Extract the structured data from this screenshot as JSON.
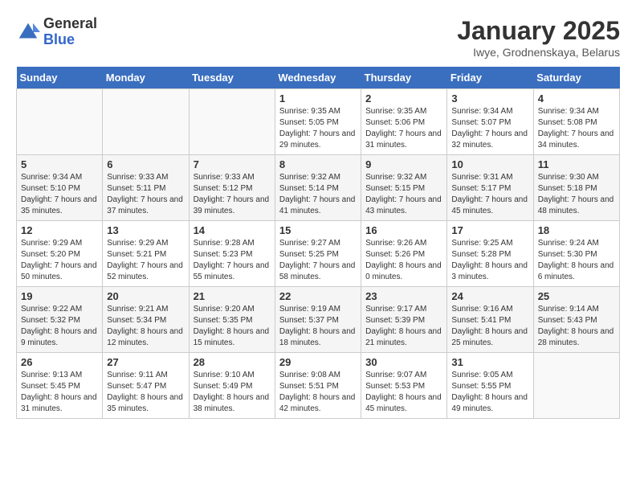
{
  "logo": {
    "general": "General",
    "blue": "Blue"
  },
  "title": "January 2025",
  "subtitle": "Iwye, Grodnenskaya, Belarus",
  "days_of_week": [
    "Sunday",
    "Monday",
    "Tuesday",
    "Wednesday",
    "Thursday",
    "Friday",
    "Saturday"
  ],
  "weeks": [
    [
      {
        "day": "",
        "info": ""
      },
      {
        "day": "",
        "info": ""
      },
      {
        "day": "",
        "info": ""
      },
      {
        "day": "1",
        "info": "Sunrise: 9:35 AM\nSunset: 5:05 PM\nDaylight: 7 hours and 29 minutes."
      },
      {
        "day": "2",
        "info": "Sunrise: 9:35 AM\nSunset: 5:06 PM\nDaylight: 7 hours and 31 minutes."
      },
      {
        "day": "3",
        "info": "Sunrise: 9:34 AM\nSunset: 5:07 PM\nDaylight: 7 hours and 32 minutes."
      },
      {
        "day": "4",
        "info": "Sunrise: 9:34 AM\nSunset: 5:08 PM\nDaylight: 7 hours and 34 minutes."
      }
    ],
    [
      {
        "day": "5",
        "info": "Sunrise: 9:34 AM\nSunset: 5:10 PM\nDaylight: 7 hours and 35 minutes."
      },
      {
        "day": "6",
        "info": "Sunrise: 9:33 AM\nSunset: 5:11 PM\nDaylight: 7 hours and 37 minutes."
      },
      {
        "day": "7",
        "info": "Sunrise: 9:33 AM\nSunset: 5:12 PM\nDaylight: 7 hours and 39 minutes."
      },
      {
        "day": "8",
        "info": "Sunrise: 9:32 AM\nSunset: 5:14 PM\nDaylight: 7 hours and 41 minutes."
      },
      {
        "day": "9",
        "info": "Sunrise: 9:32 AM\nSunset: 5:15 PM\nDaylight: 7 hours and 43 minutes."
      },
      {
        "day": "10",
        "info": "Sunrise: 9:31 AM\nSunset: 5:17 PM\nDaylight: 7 hours and 45 minutes."
      },
      {
        "day": "11",
        "info": "Sunrise: 9:30 AM\nSunset: 5:18 PM\nDaylight: 7 hours and 48 minutes."
      }
    ],
    [
      {
        "day": "12",
        "info": "Sunrise: 9:29 AM\nSunset: 5:20 PM\nDaylight: 7 hours and 50 minutes."
      },
      {
        "day": "13",
        "info": "Sunrise: 9:29 AM\nSunset: 5:21 PM\nDaylight: 7 hours and 52 minutes."
      },
      {
        "day": "14",
        "info": "Sunrise: 9:28 AM\nSunset: 5:23 PM\nDaylight: 7 hours and 55 minutes."
      },
      {
        "day": "15",
        "info": "Sunrise: 9:27 AM\nSunset: 5:25 PM\nDaylight: 7 hours and 58 minutes."
      },
      {
        "day": "16",
        "info": "Sunrise: 9:26 AM\nSunset: 5:26 PM\nDaylight: 8 hours and 0 minutes."
      },
      {
        "day": "17",
        "info": "Sunrise: 9:25 AM\nSunset: 5:28 PM\nDaylight: 8 hours and 3 minutes."
      },
      {
        "day": "18",
        "info": "Sunrise: 9:24 AM\nSunset: 5:30 PM\nDaylight: 8 hours and 6 minutes."
      }
    ],
    [
      {
        "day": "19",
        "info": "Sunrise: 9:22 AM\nSunset: 5:32 PM\nDaylight: 8 hours and 9 minutes."
      },
      {
        "day": "20",
        "info": "Sunrise: 9:21 AM\nSunset: 5:34 PM\nDaylight: 8 hours and 12 minutes."
      },
      {
        "day": "21",
        "info": "Sunrise: 9:20 AM\nSunset: 5:35 PM\nDaylight: 8 hours and 15 minutes."
      },
      {
        "day": "22",
        "info": "Sunrise: 9:19 AM\nSunset: 5:37 PM\nDaylight: 8 hours and 18 minutes."
      },
      {
        "day": "23",
        "info": "Sunrise: 9:17 AM\nSunset: 5:39 PM\nDaylight: 8 hours and 21 minutes."
      },
      {
        "day": "24",
        "info": "Sunrise: 9:16 AM\nSunset: 5:41 PM\nDaylight: 8 hours and 25 minutes."
      },
      {
        "day": "25",
        "info": "Sunrise: 9:14 AM\nSunset: 5:43 PM\nDaylight: 8 hours and 28 minutes."
      }
    ],
    [
      {
        "day": "26",
        "info": "Sunrise: 9:13 AM\nSunset: 5:45 PM\nDaylight: 8 hours and 31 minutes."
      },
      {
        "day": "27",
        "info": "Sunrise: 9:11 AM\nSunset: 5:47 PM\nDaylight: 8 hours and 35 minutes."
      },
      {
        "day": "28",
        "info": "Sunrise: 9:10 AM\nSunset: 5:49 PM\nDaylight: 8 hours and 38 minutes."
      },
      {
        "day": "29",
        "info": "Sunrise: 9:08 AM\nSunset: 5:51 PM\nDaylight: 8 hours and 42 minutes."
      },
      {
        "day": "30",
        "info": "Sunrise: 9:07 AM\nSunset: 5:53 PM\nDaylight: 8 hours and 45 minutes."
      },
      {
        "day": "31",
        "info": "Sunrise: 9:05 AM\nSunset: 5:55 PM\nDaylight: 8 hours and 49 minutes."
      },
      {
        "day": "",
        "info": ""
      }
    ]
  ]
}
